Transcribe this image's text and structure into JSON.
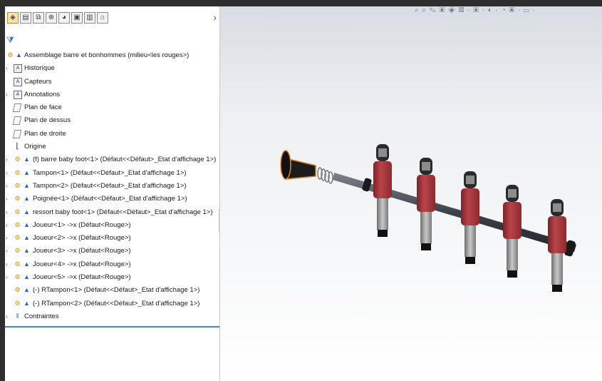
{
  "toolbar": {
    "tabs": [
      "feature-manager-icon",
      "property-icon",
      "configuration-icon",
      "dimxpert-icon",
      "display-icon",
      "cam-icon",
      "motion-icon",
      "filter-icon"
    ],
    "more_glyph": "›"
  },
  "filter_glyph": "⧩",
  "tree": {
    "items": [
      {
        "label": "Assemblage barre et bonhommes  (milieu<les rouges>)",
        "kind": "assembly",
        "expand": ""
      },
      {
        "label": "Historique",
        "kind": "folder",
        "expand": "›"
      },
      {
        "label": "Capteurs",
        "kind": "folder",
        "expand": ""
      },
      {
        "label": "Annotations",
        "kind": "folder",
        "expand": "›"
      },
      {
        "label": "Plan de face",
        "kind": "plane",
        "expand": ""
      },
      {
        "label": "Plan de dessus",
        "kind": "plane",
        "expand": ""
      },
      {
        "label": "Plan de droite",
        "kind": "plane",
        "expand": ""
      },
      {
        "label": "Origine",
        "kind": "origin",
        "expand": ""
      },
      {
        "label": "(f) barre baby foot<1> (Défaut<<Défaut>_Etat d'affichage 1>)",
        "kind": "part",
        "expand": "›"
      },
      {
        "label": "Tampon<1> (Défaut<<Défaut>_Etat d'affichage 1>)",
        "kind": "part",
        "expand": "›"
      },
      {
        "label": "Tampon<2> (Défaut<<Défaut>_Etat d'affichage 1>)",
        "kind": "part",
        "expand": "›"
      },
      {
        "label": "Poignée<1> (Défaut<<Défaut>_Etat d'affichage 1>)",
        "kind": "part",
        "expand": "›"
      },
      {
        "label": "ressort baby foot<1> (Défaut<<Défaut>_Etat d'affichage 1>)",
        "kind": "part",
        "expand": "›"
      },
      {
        "label": "Joueur<1> ->x (Défaut<Rouge>)",
        "kind": "part",
        "expand": "›"
      },
      {
        "label": "Joueur<2> ->x (Défaut<Rouge>)",
        "kind": "part",
        "expand": "›"
      },
      {
        "label": "Joueur<3> ->x (Défaut<Rouge>)",
        "kind": "part",
        "expand": "›"
      },
      {
        "label": "Joueur<4> ->x (Défaut<Rouge>)",
        "kind": "part",
        "expand": "›"
      },
      {
        "label": "Joueur<5> ->x (Défaut<Rouge>)",
        "kind": "part",
        "expand": "›"
      },
      {
        "label": "(-) RTampon<1> (Défaut<<Défaut>_Etat d'affichage 1>)",
        "kind": "part",
        "expand": ""
      },
      {
        "label": "(-) RTampon<2> (Défaut<<Défaut>_Etat d'affichage 1>)",
        "kind": "part",
        "expand": ""
      },
      {
        "label": "Contraintes",
        "kind": "mates",
        "expand": "›"
      }
    ]
  },
  "heads_up_toolbar": "⌕ ⌕ ✎ ▣ ◈ ▦ · ▣ · ◐ · ◔ ▣ · ▭ ·",
  "colors": {
    "accent": "#3a87c9",
    "player_red": "#a8353c",
    "rod": "#4a4e55",
    "handle": "#1b1b1b"
  }
}
